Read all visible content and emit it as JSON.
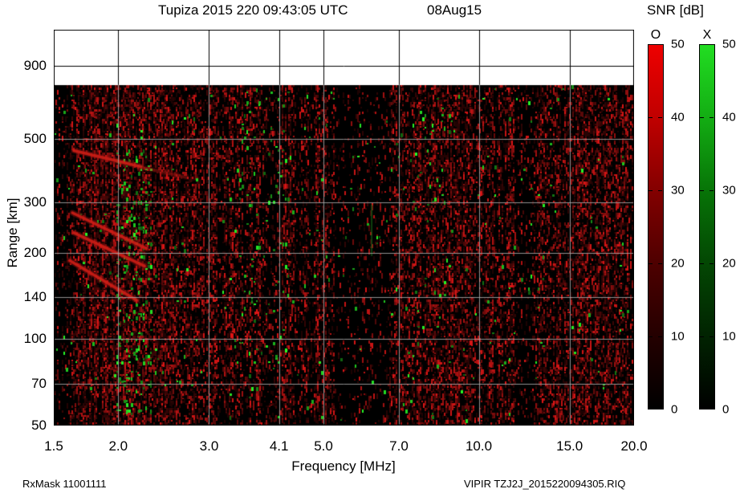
{
  "header": {
    "title": "Tupiza 2015 220 09:43:05 UTC",
    "date": "08Aug15"
  },
  "footer": {
    "left": "RxMask 11001111",
    "right": "VIPIR  TZJ2J_2015220094305.RIQ"
  },
  "legend": {
    "title": "SNR [dB]",
    "ticks": [
      "50",
      "40",
      "30",
      "20",
      "10",
      "0"
    ],
    "tick_fractions": [
      0,
      0.2,
      0.4,
      0.6,
      0.8,
      1
    ],
    "bars": [
      {
        "label": "O",
        "gradient": [
          "#ee0000 0%",
          "#c00000 20%",
          "#830000 40%",
          "#4e0000 60%",
          "#240000 80%",
          "#000000 100%"
        ]
      },
      {
        "label": "X",
        "gradient": [
          "#22dd22 0%",
          "#13ad13 20%",
          "#077407 40%",
          "#034703 60%",
          "#012301 80%",
          "#000000 100%"
        ]
      }
    ]
  },
  "chart_data": {
    "type": "heatmap",
    "title": "Tupiza 2015 220 09:43:05 UTC 08Aug15",
    "xlabel": "Frequency [MHz]",
    "ylabel": "Range [km]",
    "x_scale": "log",
    "y_scale": "log",
    "xlim": [
      1.5,
      20
    ],
    "ylim": [
      50,
      1200
    ],
    "x_ticks": [
      1.5,
      2,
      3,
      4.1,
      5,
      7,
      10,
      15,
      20
    ],
    "x_tick_labels": [
      "1.5",
      "2.0",
      "3.0",
      "4.1",
      "5.0",
      "7.0",
      "10.0",
      "15.0",
      "20.0"
    ],
    "y_ticks": [
      50,
      70,
      100,
      140,
      200,
      300,
      500,
      900
    ],
    "y_tick_labels": [
      "50",
      "70",
      "100",
      "140",
      "200",
      "300",
      "500",
      "900"
    ],
    "x_grid": [
      2,
      3,
      4.1,
      5,
      7,
      10,
      15
    ],
    "y_grid": [
      70,
      100,
      140,
      200,
      300,
      500,
      900
    ],
    "grid": true,
    "snr_scale_db": [
      0,
      50
    ],
    "data_top_km": 770,
    "colors": {
      "background": "#000000",
      "above_data": "#ffffff",
      "grid_on_data": "rgba(170,170,170,0.85)",
      "grid_on_white": "#000000",
      "border": "#000000",
      "o_channel_bright": "#ee0000",
      "x_channel_bright": "#22dd22"
    },
    "echo_traces": [
      {
        "f1": 1.64,
        "r1": 455,
        "f2": 2.21,
        "r2": 400
      },
      {
        "f1": 2.22,
        "r1": 398,
        "f2": 2.72,
        "r2": 366,
        "faint": true
      },
      {
        "f1": 1.63,
        "r1": 276,
        "f2": 2.27,
        "r2": 207
      },
      {
        "f1": 1.64,
        "r1": 235,
        "f2": 2.25,
        "r2": 180
      },
      {
        "f1": 1.61,
        "r1": 188,
        "f2": 2.17,
        "r2": 137
      }
    ],
    "green_streaks": [
      {
        "f": 6.2,
        "r1": 195,
        "r2": 295
      }
    ],
    "noise": {
      "seed": 1337,
      "red_density": 0.33,
      "green_density": 0.012,
      "dark_bands": [
        {
          "f1": 1.5,
          "f2": 1.63,
          "k": 0.45
        },
        {
          "f1": 3.82,
          "f2": 4.06,
          "k": 0.45
        },
        {
          "f1": 4.35,
          "f2": 4.8,
          "k": 0.6
        },
        {
          "f1": 5.25,
          "f2": 6.7,
          "k": 0.3
        },
        {
          "f1": 11.7,
          "f2": 12.6,
          "k": 0.5
        }
      ],
      "dense_bands": [
        {
          "f1": 1.7,
          "f2": 2.6,
          "k": 1.5
        },
        {
          "f1": 7.4,
          "f2": 9.5,
          "k": 1.25
        },
        {
          "f1": 15.5,
          "f2": 20,
          "k": 1.25
        }
      ],
      "green_bands": [
        {
          "f1": 1.98,
          "f2": 2.32,
          "k": 14,
          "r1": 55,
          "r2": 460
        },
        {
          "f1": 3.35,
          "f2": 4.3,
          "k": 4,
          "r1": 80,
          "r2": 720
        },
        {
          "f1": 7.4,
          "f2": 8.8,
          "k": 2.5,
          "r1": 80,
          "r2": 720
        }
      ]
    }
  }
}
